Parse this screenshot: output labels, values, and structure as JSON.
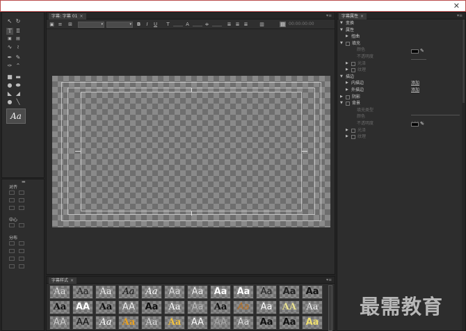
{
  "window": {
    "close_glyph": "✕"
  },
  "editor": {
    "tab_label": "字幕: 字幕 01",
    "tab_close": "×",
    "timecode": "00:00:00:00"
  },
  "properties": {
    "tab_label": "字幕属性",
    "tab_close": "×",
    "rows": [
      {
        "label": "变换",
        "level": 0,
        "expanded": true,
        "dim": false
      },
      {
        "label": "属性",
        "level": 0,
        "expanded": true,
        "dim": false
      },
      {
        "label": "扭曲",
        "level": 1,
        "expanded": false,
        "dim": false
      },
      {
        "label": "填充",
        "level": 0,
        "expanded": true,
        "dim": false,
        "checkbox": true
      },
      {
        "label": "颜色",
        "level": 2,
        "dim": true
      },
      {
        "label": "不透明度",
        "level": 2,
        "dim": true
      },
      {
        "label": "光泽",
        "level": 1,
        "expanded": false,
        "dim": true,
        "checkbox": true
      },
      {
        "label": "纹理",
        "level": 1,
        "expanded": false,
        "dim": true,
        "checkbox": true
      },
      {
        "label": "描边",
        "level": 0,
        "expanded": true,
        "dim": false
      },
      {
        "label": "内描边",
        "level": 1,
        "expanded": false,
        "dim": false,
        "link": "添加"
      },
      {
        "label": "外描边",
        "level": 1,
        "expanded": false,
        "dim": false,
        "link": "添加"
      },
      {
        "label": "阴影",
        "level": 0,
        "expanded": false,
        "dim": false,
        "checkbox": true
      },
      {
        "label": "背景",
        "level": 0,
        "expanded": true,
        "dim": false,
        "checkbox": true
      },
      {
        "label": "填充类型",
        "level": 2,
        "dim": true
      },
      {
        "label": "颜色",
        "level": 2,
        "dim": true
      },
      {
        "label": "不透明度",
        "level": 2,
        "dim": true,
        "value": "100 %"
      },
      {
        "label": "光泽",
        "level": 1,
        "expanded": false,
        "dim": true,
        "checkbox": true
      },
      {
        "label": "纹理",
        "level": 1,
        "expanded": false,
        "dim": true,
        "checkbox": true
      }
    ]
  },
  "tools": {
    "preview_text": "Aa",
    "align_label": "对齐",
    "center_label": "中心",
    "distribute_label": "分布"
  },
  "styles": {
    "tab_label": "字幕样式",
    "tab_close": "×",
    "items": [
      "Aa",
      "Aa",
      "Aa",
      "Aa",
      "Aa",
      "Aa",
      "Aa",
      "Aa",
      "Aa",
      "Aa",
      "Aa",
      "Aa",
      "Aa",
      "AA",
      "Aa",
      "AA",
      "Aa",
      "Aa",
      "Aa",
      "Aa",
      "Aa",
      "Aa",
      "AA",
      "Aa",
      "AA",
      "AA",
      "Aa",
      "Aa",
      "Aa",
      "Aa",
      "AA",
      "AA",
      "Aa",
      "Aa",
      "Aa",
      "Aa"
    ]
  },
  "watermark": "最需教育",
  "colors": {
    "fill_swatch": "#050505",
    "background_swatch": "#050505",
    "accent": "#e8c54a"
  }
}
